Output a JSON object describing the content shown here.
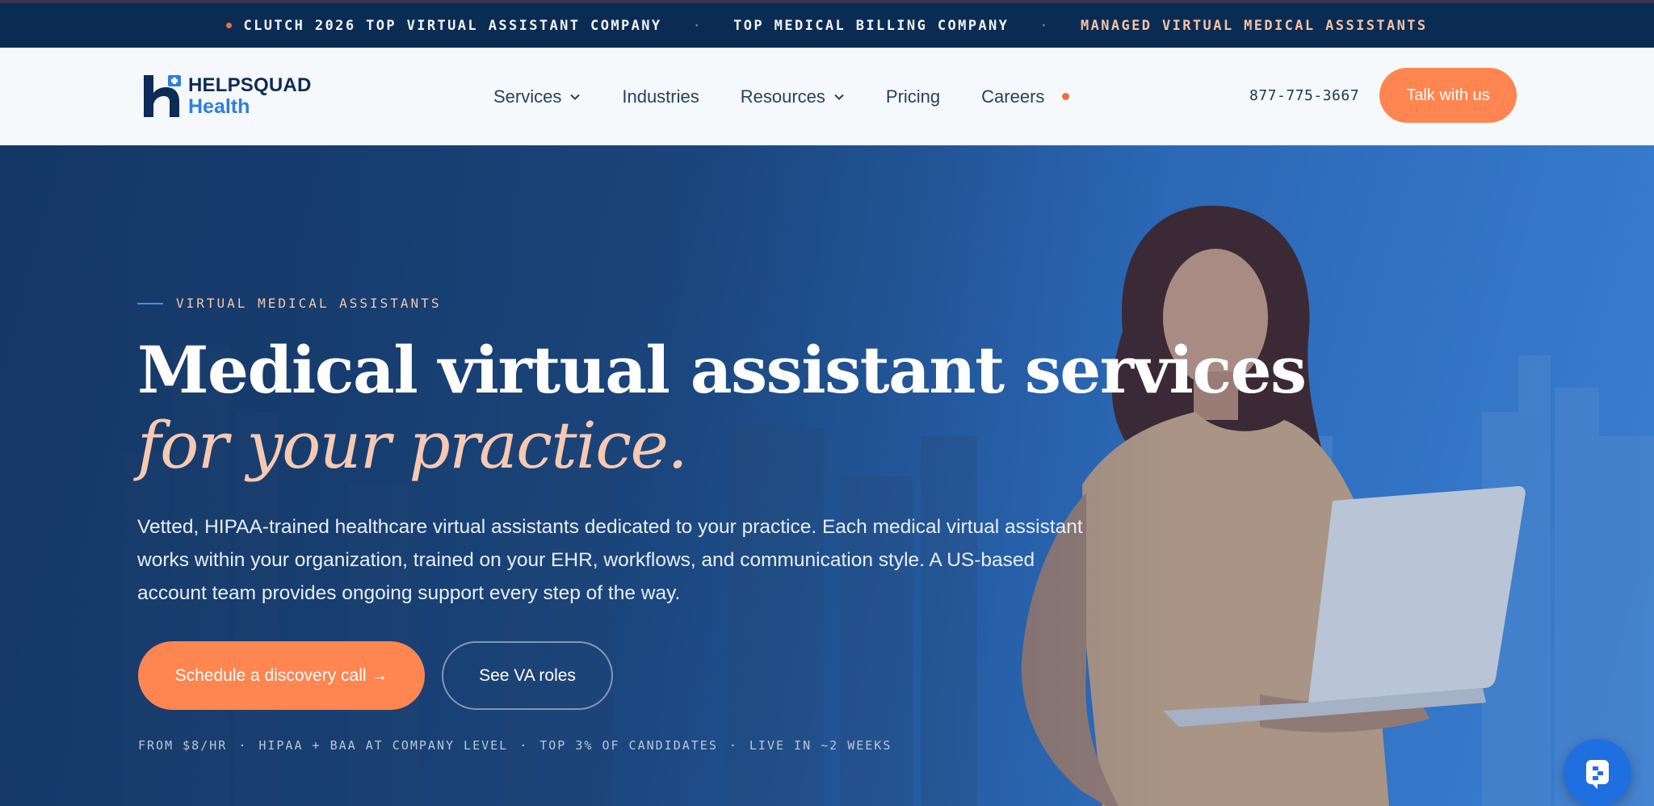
{
  "announcement": {
    "items": [
      "CLUTCH 2026 TOP VIRTUAL ASSISTANT COMPANY",
      "TOP MEDICAL BILLING COMPANY",
      "MANAGED VIRTUAL MEDICAL ASSISTANTS"
    ],
    "separator": "·"
  },
  "header": {
    "logo": {
      "line1": "HELPSQUAD",
      "line2": "Health"
    },
    "nav": [
      {
        "label": "Services",
        "has_dropdown": true
      },
      {
        "label": "Industries",
        "has_dropdown": false
      },
      {
        "label": "Resources",
        "has_dropdown": true
      },
      {
        "label": "Pricing",
        "has_dropdown": false
      },
      {
        "label": "Careers",
        "has_dropdown": false
      }
    ],
    "phone": "877-775-3667",
    "cta_label": "Talk with us"
  },
  "hero": {
    "eyebrow": "VIRTUAL MEDICAL ASSISTANTS",
    "title_line1": "Medical virtual assistant services",
    "title_line2": "for your practice.",
    "lede": "Vetted, HIPAA-trained healthcare virtual assistants dedicated to your practice. Each medical virtual assistant works within your organization, trained on your EHR, workflows, and communication style. A US-based account team provides ongoing support every step of the way.",
    "primary_cta": "Schedule a discovery call →",
    "secondary_cta": "See VA roles",
    "trust_items": [
      "FROM $8/HR",
      "HIPAA + BAA AT COMPANY LEVEL",
      "TOP 3% OF CANDIDATES",
      "LIVE IN ~2 WEEKS"
    ],
    "trust_separator": "·"
  },
  "colors": {
    "navy": "#0b2c52",
    "accent_orange": "#ff8551",
    "brand_blue": "#2d7ee0",
    "peach": "#f6c9b3"
  },
  "icons": {
    "nav_dropdown": "chevron-down-icon",
    "chat": "chat-icon"
  }
}
